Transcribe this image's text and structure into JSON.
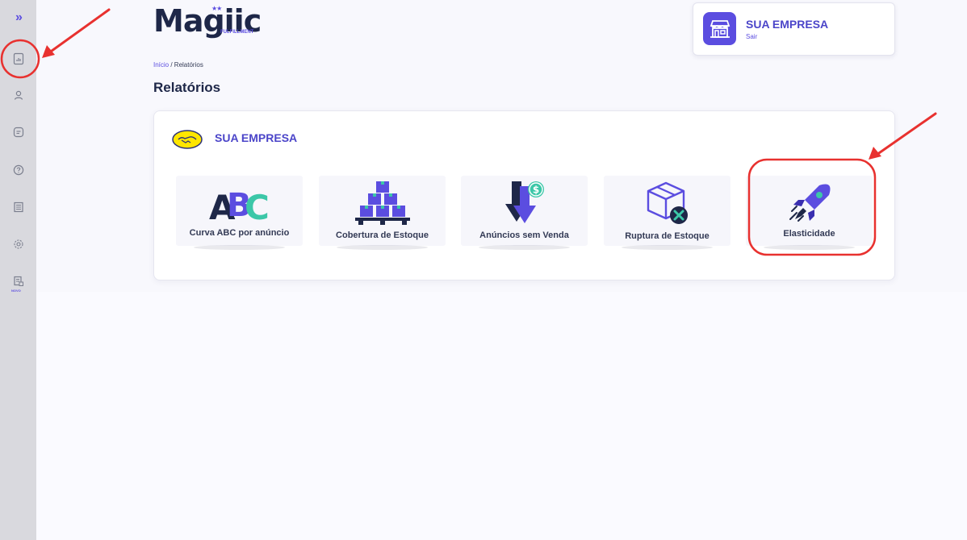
{
  "sidebar": {
    "expand_icon": "»",
    "items": [
      {
        "name": "reports-icon"
      },
      {
        "name": "user-icon"
      },
      {
        "name": "messages-icon"
      },
      {
        "name": "help-icon"
      },
      {
        "name": "list-icon"
      },
      {
        "name": "settings-icon"
      },
      {
        "name": "document-new-icon"
      }
    ],
    "new_badge": "NOVO"
  },
  "header": {
    "logo": "Magiic",
    "logo_sub": "FULFILLMENT",
    "company_name": "SUA EMPRESA",
    "logout_label": "Sair"
  },
  "breadcrumb": {
    "home": "Início",
    "separator": " / ",
    "current": "Relatórios"
  },
  "page_title": "Relatórios",
  "panel": {
    "company_name": "SUA EMPRESA",
    "reports": [
      {
        "label": "Curva ABC por anúncio",
        "icon": "abc-icon"
      },
      {
        "label": "Cobertura de Estoque",
        "icon": "boxes-stack-icon"
      },
      {
        "label": "Anúncios sem Venda",
        "icon": "arrow-down-dollar-icon"
      },
      {
        "label": "Ruptura de Estoque",
        "icon": "box-x-icon"
      },
      {
        "label": "Elasticidade",
        "icon": "rocket-icon"
      }
    ]
  },
  "colors": {
    "accent": "#5b4de0",
    "navy": "#1e2748",
    "teal": "#3cc7a8",
    "annotation": "#e8312f"
  }
}
